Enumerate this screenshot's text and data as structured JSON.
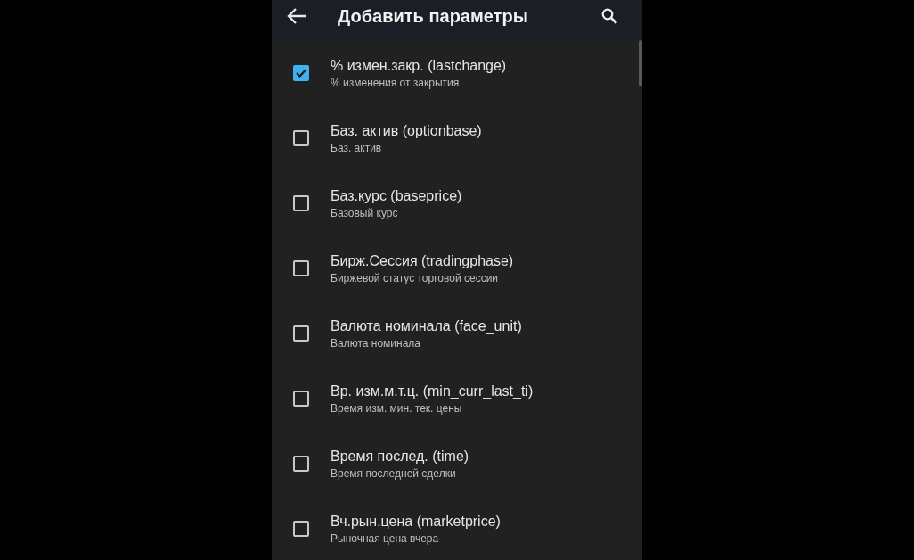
{
  "app_bar": {
    "title": "Добавить параметры"
  },
  "items": [
    {
      "title": "% измен.закр. (lastchange)",
      "subtitle": "% изменения от закрытия",
      "checked": true
    },
    {
      "title": "Баз. актив (optionbase)",
      "subtitle": "Баз. актив",
      "checked": false
    },
    {
      "title": "Баз.курс (baseprice)",
      "subtitle": "Базовый курс",
      "checked": false
    },
    {
      "title": "Бирж.Сессия (tradingphase)",
      "subtitle": "Биржевой статус торговой сессии",
      "checked": false
    },
    {
      "title": "Валюта номинала (face_unit)",
      "subtitle": "Валюта номинала",
      "checked": false
    },
    {
      "title": "Вр. изм.м.т.ц. (min_curr_last_ti)",
      "subtitle": "Время изм. мин. тек. цены",
      "checked": false
    },
    {
      "title": "Время послед. (time)",
      "subtitle": "Время последней сделки",
      "checked": false
    },
    {
      "title": "Вч.рын.цена (marketprice)",
      "subtitle": "Рыночная цена вчера",
      "checked": false
    }
  ]
}
